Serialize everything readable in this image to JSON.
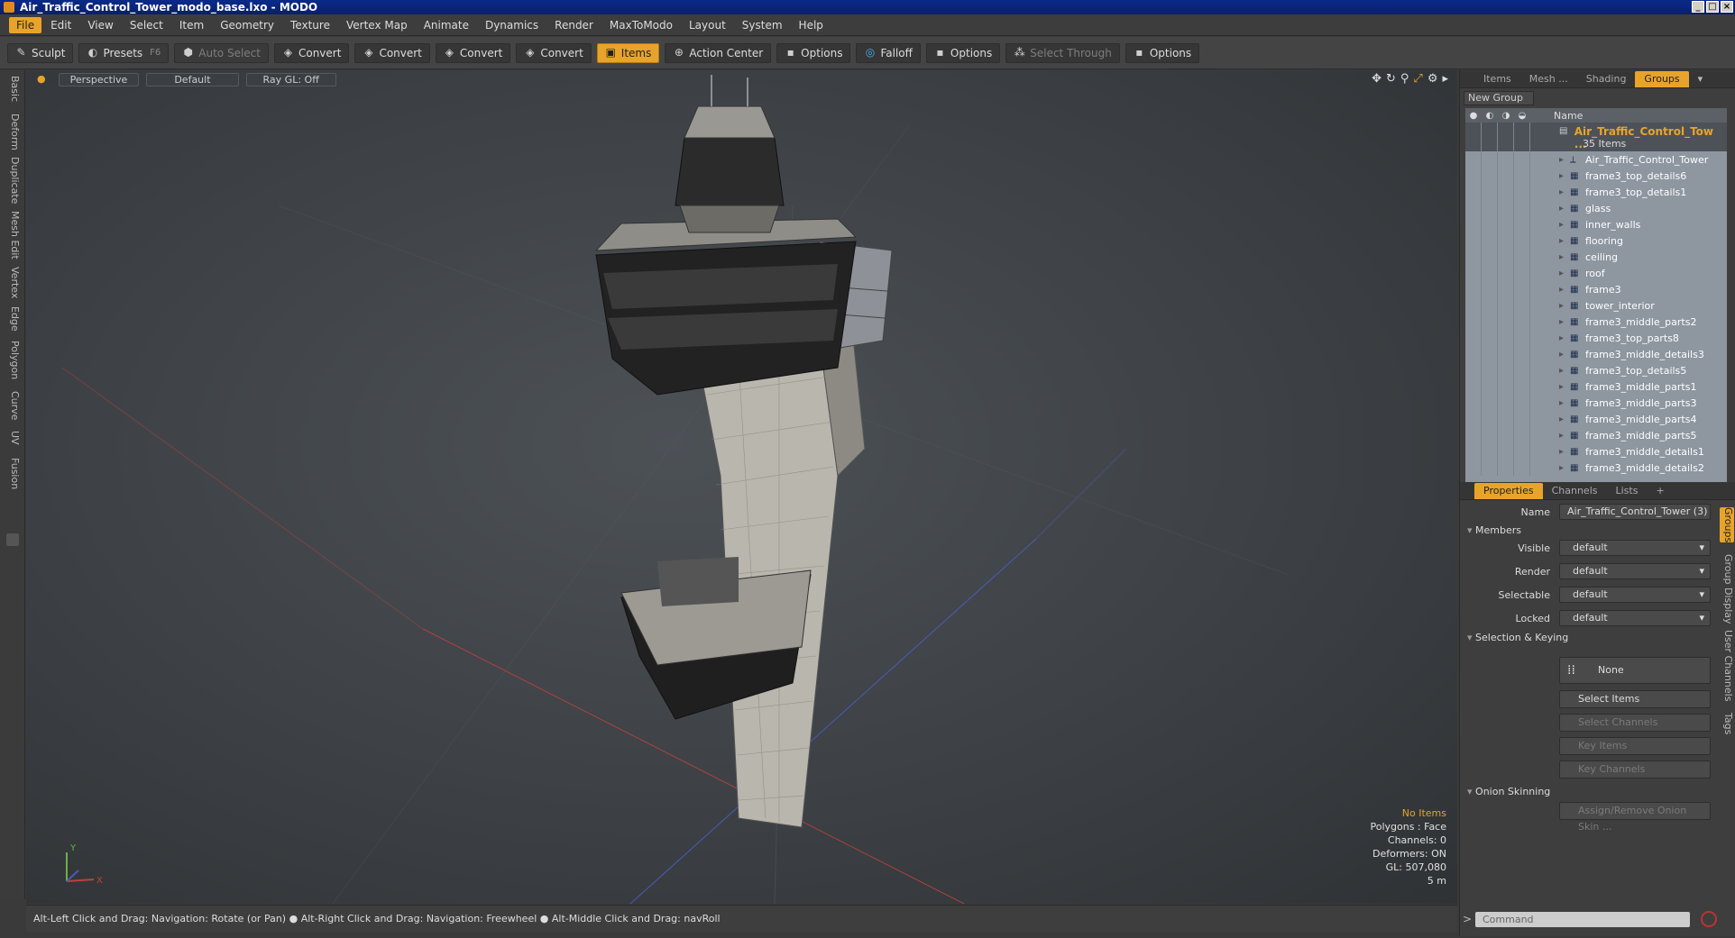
{
  "window": {
    "title": "Air_Traffic_Control_Tower_modo_base.lxo - MODO"
  },
  "menu": [
    "File",
    "Edit",
    "View",
    "Select",
    "Item",
    "Geometry",
    "Texture",
    "Vertex Map",
    "Animate",
    "Dynamics",
    "Render",
    "MaxToModo",
    "Layout",
    "System",
    "Help"
  ],
  "toolbar": {
    "sculpt": "Sculpt",
    "presets": "Presets",
    "presets_key": "F6",
    "auto_select": "Auto Select",
    "convert1": "Convert",
    "convert2": "Convert",
    "convert3": "Convert",
    "convert4": "Convert",
    "items": "Items",
    "action_center": "Action Center",
    "options1": "Options",
    "falloff": "Falloff",
    "options2": "Options",
    "select_through": "Select Through",
    "options3": "Options"
  },
  "left_tabs": [
    "Basic",
    "Deform",
    "Duplicate",
    "Mesh Edit",
    "Vertex",
    "Edge",
    "Polygon",
    "Curve",
    "UV",
    "Fusion"
  ],
  "viewport": {
    "view": "Perspective",
    "shading": "Default",
    "raygl": "Ray GL: Off",
    "stats": {
      "items": "No Items",
      "polygons": "Polygons : Face",
      "channels": "Channels: 0",
      "deformers": "Deformers: ON",
      "gl": "GL: 507,080",
      "scale": "5 m"
    }
  },
  "status": "Alt-Left Click and Drag: Navigation: Rotate (or Pan) ● Alt-Right Click and Drag: Navigation: Freewheel ● Alt-Middle Click and Drag: navRoll",
  "groups_panel": {
    "tabs": [
      "Items",
      "Mesh ...",
      "Shading",
      "Groups"
    ],
    "new_group": "New Group",
    "name_header": "Name",
    "group_name": "Air_Traffic_Control_Tow ...",
    "group_count": "35 Items",
    "items": [
      "Air_Traffic_Control_Tower",
      "frame3_top_details6",
      "frame3_top_details1",
      "glass",
      "inner_walls",
      "flooring",
      "ceiling",
      "roof",
      "frame3",
      "tower_interior",
      "frame3_middle_parts2",
      "frame3_top_parts8",
      "frame3_middle_details3",
      "frame3_top_details5",
      "frame3_middle_parts1",
      "frame3_middle_parts3",
      "frame3_middle_parts4",
      "frame3_middle_parts5",
      "frame3_middle_details1",
      "frame3_middle_details2"
    ]
  },
  "properties": {
    "tabs": [
      "Properties",
      "Channels",
      "Lists",
      "+"
    ],
    "name_label": "Name",
    "name_value": "Air_Traffic_Control_Tower (3)",
    "members": "Members",
    "visible_label": "Visible",
    "visible": "default",
    "render_label": "Render",
    "render": "default",
    "selectable_label": "Selectable",
    "selectable": "default",
    "locked_label": "Locked",
    "locked": "default",
    "selection_keying": "Selection & Keying",
    "none": "None",
    "select_items": "Select Items",
    "select_channels": "Select Channels",
    "key_items": "Key Items",
    "key_channels": "Key Channels",
    "onion": "Onion Skinning",
    "assign_onion": "Assign/Remove Onion Skin ...",
    "side_tabs": [
      "Groups",
      "Group Display",
      "User Channels",
      "Tags"
    ]
  },
  "command": {
    "placeholder": "Command"
  }
}
